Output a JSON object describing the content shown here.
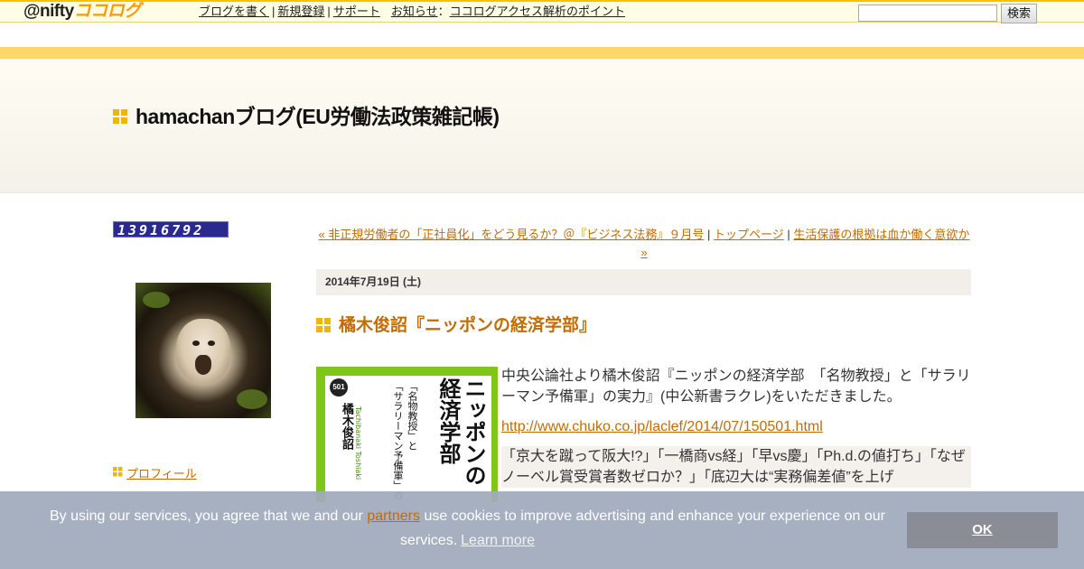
{
  "topbar": {
    "logo_at": "@nifty",
    "logo_brand": "ココログ",
    "links": [
      "ブログを書く",
      "新規登録",
      "サポート"
    ],
    "notice_label": "お知らせ",
    "notice_link": "ココログアクセス解析のポイント",
    "search_placeholder": "",
    "search_button": "検索"
  },
  "header": {
    "title": "hamachanブログ(EU労働法政策雑記帳)"
  },
  "sidebar": {
    "counter": "13916792",
    "profile_link": "プロフィール"
  },
  "post_nav": {
    "prev": "« 非正規労働者の「正社員化」をどう見るか？＠『ビジネス法務』９月号",
    "sep": "|",
    "home": "トップページ",
    "next": "生活保護の根拠は血か働く意欲か »"
  },
  "post": {
    "date": "2014年7月19日 (土)",
    "title": "橘木俊詔『ニッポンの経済学部』",
    "body": "中央公論社より橘木俊詔『ニッポンの経済学部　「名物教授」と「サラリーマン予備軍」の実力』(中公新書ラクレ)をいただきました。",
    "link": "http://www.chuko.co.jp/laclef/2014/07/150501.html",
    "quote": "「京大を蹴って阪大!?」「一橋商vs経」「早vs慶」「Ph.d.の値打ち」「なぜノーベル賞受賞者数ゼロか？」「底辺大は“実務偏差値”を上げ"
  },
  "book_cover": {
    "series_no": "501",
    "author": "橘木俊詔",
    "author_romaji": "Tachibanaki Toshiaki",
    "subtitle_line1": "「名物教授」と",
    "subtitle_line2": "「サラリーマン予備軍」の",
    "main_title_line1": "ニッポンの",
    "main_title_line2": "経済学部"
  },
  "cookie": {
    "text_before": "By using our services, you agree that we and our ",
    "partners": "partners",
    "text_after": " use cookies to improve advertising and enhance your experience on our services.",
    "learn_more": "Learn more",
    "ok": "OK"
  },
  "colors": {
    "accent_orange": "#c36c00",
    "brand_yellow": "#f2b400",
    "stripe": "#fcd76a",
    "cookie_bg": "#a0aabc",
    "book_green": "#7ec61a"
  }
}
